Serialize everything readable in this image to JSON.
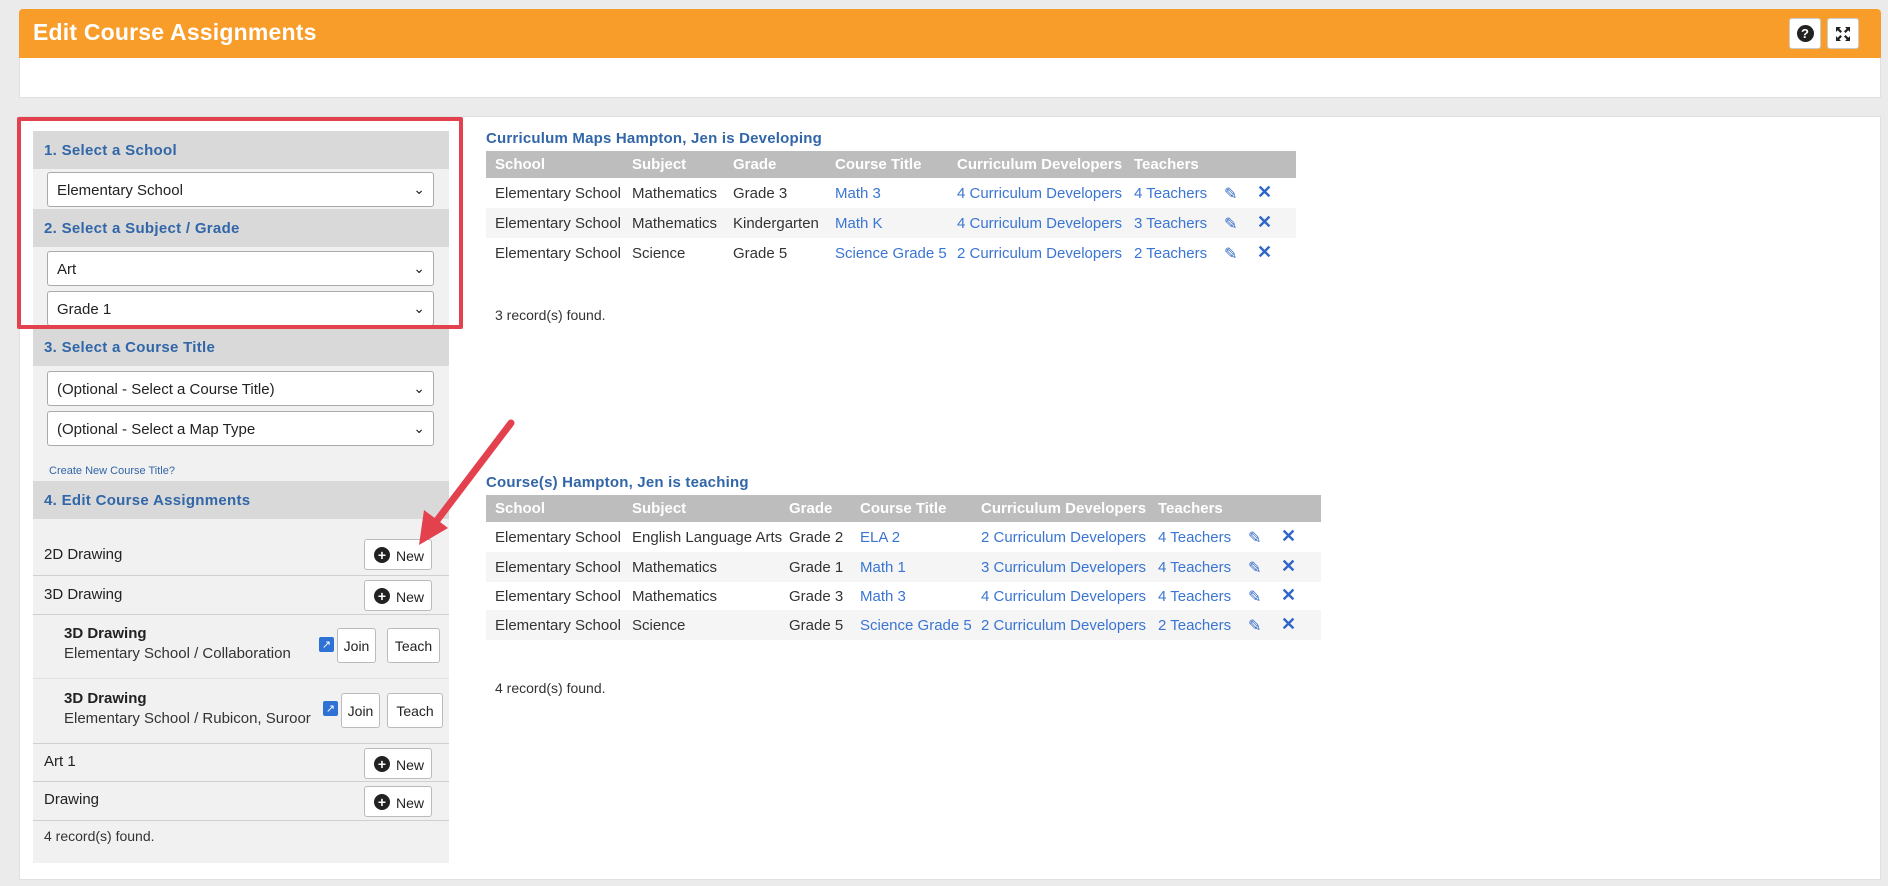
{
  "header": {
    "title": "Edit Course Assignments",
    "help_label": "?"
  },
  "left": {
    "sec1": "1. Select a School",
    "school_value": "Elementary School",
    "sec2": "2. Select a Subject / Grade",
    "subject_value": "Art",
    "grade_value": "Grade 1",
    "sec3": "3. Select a Course Title",
    "course_value": "(Optional - Select a Course Title)",
    "maptype_value": "(Optional - Select a Map Type",
    "create_link": "Create New Course Title?",
    "sec4": "4. Edit Course Assignments",
    "new_label": "New",
    "join_label": "Join",
    "teach_label": "Teach",
    "courses": [
      "2D Drawing",
      "3D Drawing",
      "Art 1",
      "Drawing"
    ],
    "sub_items": [
      {
        "title": "3D Drawing",
        "detail": "Elementary School / Collaboration"
      },
      {
        "title": "3D Drawing",
        "detail": "Elementary School / Rubicon, Suroor"
      }
    ],
    "records": "4 record(s) found."
  },
  "maps": {
    "title": "Curriculum Maps Hampton, Jen is Developing",
    "headers": [
      "School",
      "Subject",
      "Grade",
      "Course Title",
      "Curriculum Developers",
      "Teachers"
    ],
    "rows": [
      [
        "Elementary School",
        "Mathematics",
        "Grade 3",
        "Math 3",
        "4 Curriculum Developers",
        "4 Teachers"
      ],
      [
        "Elementary School",
        "Mathematics",
        "Kindergarten",
        "Math K",
        "4 Curriculum Developers",
        "3 Teachers"
      ],
      [
        "Elementary School",
        "Science",
        "Grade 5",
        "Science Grade 5",
        "2 Curriculum Developers",
        "2 Teachers"
      ]
    ],
    "records": "3 record(s) found."
  },
  "courses": {
    "title": "Course(s) Hampton, Jen is teaching",
    "headers": [
      "School",
      "Subject",
      "Grade",
      "Course Title",
      "Curriculum Developers",
      "Teachers"
    ],
    "rows": [
      [
        "Elementary School",
        "English Language Arts",
        "Grade 2",
        "ELA 2",
        "2 Curriculum Developers",
        "4 Teachers"
      ],
      [
        "Elementary School",
        "Mathematics",
        "Grade 1",
        "Math 1",
        "3 Curriculum Developers",
        "4 Teachers"
      ],
      [
        "Elementary School",
        "Mathematics",
        "Grade 3",
        "Math 3",
        "4 Curriculum Developers",
        "4 Teachers"
      ],
      [
        "Elementary School",
        "Science",
        "Grade 5",
        "Science Grade 5",
        "2 Curriculum Developers",
        "2 Teachers"
      ]
    ],
    "records": "4 record(s) found."
  },
  "colors": {
    "header": "#f99d2a",
    "link": "#3a75d3",
    "highlight": "#e3414e",
    "table_header": "#bdbdbd"
  }
}
